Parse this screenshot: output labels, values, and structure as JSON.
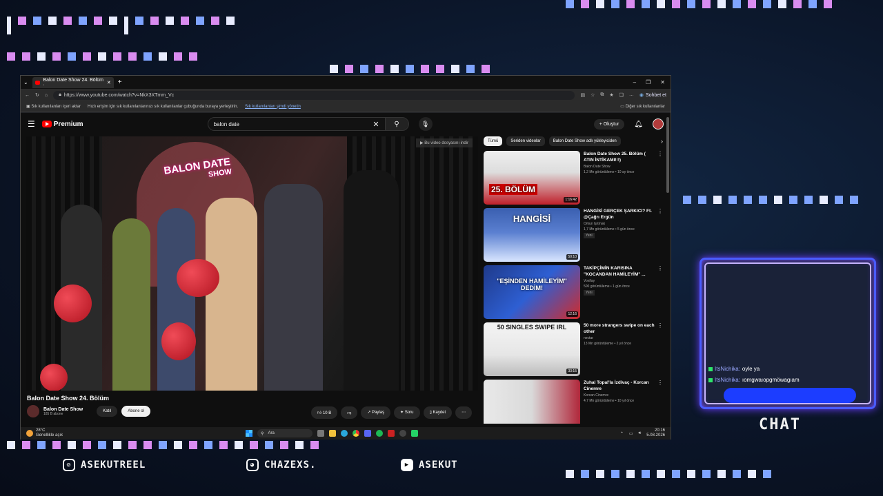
{
  "browser": {
    "tab_title": "Balon Date Show 24. Bölüm ·",
    "url": "https://www.youtube.com/watch?v=NkX3XTmm_Vc",
    "chat_button": "Sohbet et",
    "bookmarks": {
      "import": "Sık kullanılanları içeri aktar",
      "hint": "Hızlı erişim için sık kullanılanlarınızı sık kullanılanlar çubuğunda buraya yerleştirin.",
      "hint_link": "Sık kullanılanları şimdi yönetin",
      "other": "Diğer sık kullanılanlar"
    }
  },
  "youtube": {
    "logo": "Premium",
    "search_query": "balon date",
    "create_label": "Oluştur",
    "player_notice": "Bu video dosyasını indir",
    "video_title": "Balon Date Show 24. Bölüm",
    "channel_name": "Balon Date Show",
    "subscribers": "185 B abone",
    "join_label": "Katıl",
    "subscribe_label": "Abone ol",
    "likes": "10 B",
    "share_label": "Paylaş",
    "ask_label": "Soru",
    "save_label": "Kaydet",
    "overlay_title": "BALON DATE",
    "overlay_sub": "SHOW",
    "chips": [
      "Tümü",
      "Seriden videolar",
      "Balon Date Show adlı yükleyiciden"
    ],
    "recommendations": [
      {
        "title": "Balon Date Show 25. Bölüm ( ATIN İNTİKAMI!!!)",
        "channel": "Balon Date Show",
        "meta": "1,2 Mn görüntüleme • 10 ay önce",
        "duration": "1:16:42",
        "caption": "25. BÖLÜM",
        "new": ""
      },
      {
        "title": "HANGİSİ GERÇEK ŞARKICI? Ft. @Çağrı Ergün",
        "channel": "Orkun Işıtmak",
        "meta": "1,7 Mn görüntüleme • 5 gün önce",
        "duration": "50:10",
        "caption": "HANGİSİ",
        "new": "Yeni"
      },
      {
        "title": "TAKİPÇİMİN KARISINA \"KOCANDAN HAMİLEYİM\" ...",
        "channel": "Voxifay",
        "meta": "500 görüntüleme • 1 gün önce",
        "duration": "12:16",
        "caption": "\"EŞİNDEN HAMİLEYİM\" DEDİM!",
        "new": "Yeni"
      },
      {
        "title": "50 more strangers swipe on each other",
        "channel": "nectar",
        "meta": "13 Mn görüntüleme • 2 yıl önce",
        "duration": "33:15",
        "caption": "50 SINGLES SWIPE IRL",
        "new": ""
      },
      {
        "title": "Zuhal Topal'la İzdivaç - Korcan Cinemre",
        "channel": "Korcan Cinemre",
        "meta": "4,7 Mn görüntüleme • 10 yıl önce",
        "duration": "",
        "caption": "",
        "new": ""
      }
    ]
  },
  "taskbar": {
    "temp": "28°C",
    "weather": "Genellikle açık",
    "search": "Ara",
    "time": "20:16",
    "date": "5.08.2026"
  },
  "chat": {
    "messages": [
      {
        "user": "ItsNichika:",
        "text": "oyle ya"
      },
      {
        "user": "ItsNichika:",
        "text": "ıomgwaıopgmöwagıam"
      }
    ],
    "label": "CHAT"
  },
  "socials": {
    "instagram": "ASEKUTREEL",
    "discord": "CHAZEXS.",
    "youtube": "ASEKUT"
  }
}
